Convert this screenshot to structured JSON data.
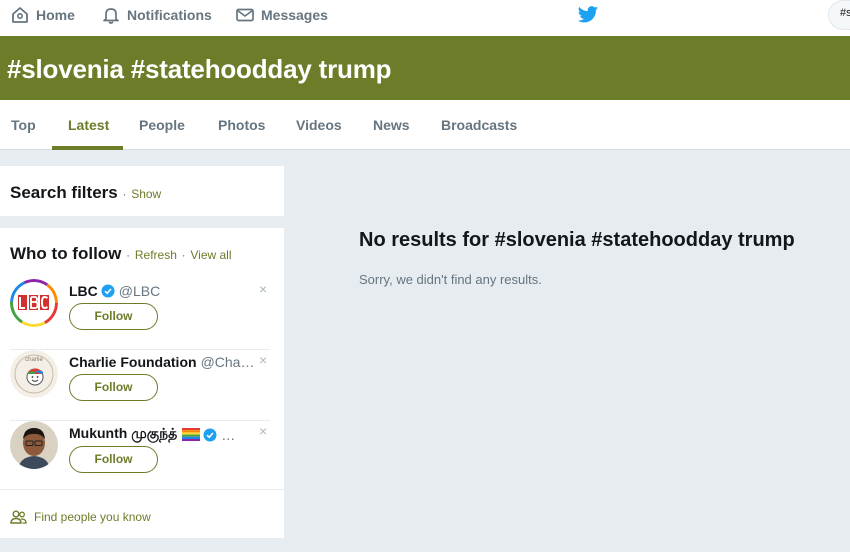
{
  "nav": {
    "home": "Home",
    "notifications": "Notifications",
    "messages": "Messages",
    "search_value": "#slovenia"
  },
  "header": {
    "title": "#slovenia #statehoodday trump"
  },
  "tabs": [
    {
      "label": "Top"
    },
    {
      "label": "Latest"
    },
    {
      "label": "People"
    },
    {
      "label": "Photos"
    },
    {
      "label": "Videos"
    },
    {
      "label": "News"
    },
    {
      "label": "Broadcasts"
    }
  ],
  "active_tab": "Latest",
  "filters": {
    "title": "Search filters",
    "sep": "·",
    "show": "Show"
  },
  "who_to_follow": {
    "title": "Who to follow",
    "sep": "·",
    "refresh": "Refresh",
    "view_all": "View all",
    "dismiss_glyph": "×",
    "suggestions": [
      {
        "name": "LBC",
        "handle": "@LBC",
        "verified": true,
        "follow": "Follow"
      },
      {
        "name": "Charlie Foundation",
        "handle": "@Cha…",
        "verified": false,
        "follow": "Follow"
      },
      {
        "name": "Mukunth முகுந்த்",
        "handle": "…",
        "verified": true,
        "follow": "Follow"
      }
    ],
    "find_people": "Find people you know"
  },
  "results": {
    "title": "No results for #slovenia #statehoodday trump",
    "message": "Sorry, we didn't find any results."
  },
  "colors": {
    "accent": "#6c7d29",
    "twitter_blue": "#1da1f2",
    "page_bg": "#e6ecf0",
    "muted": "#66757f"
  }
}
